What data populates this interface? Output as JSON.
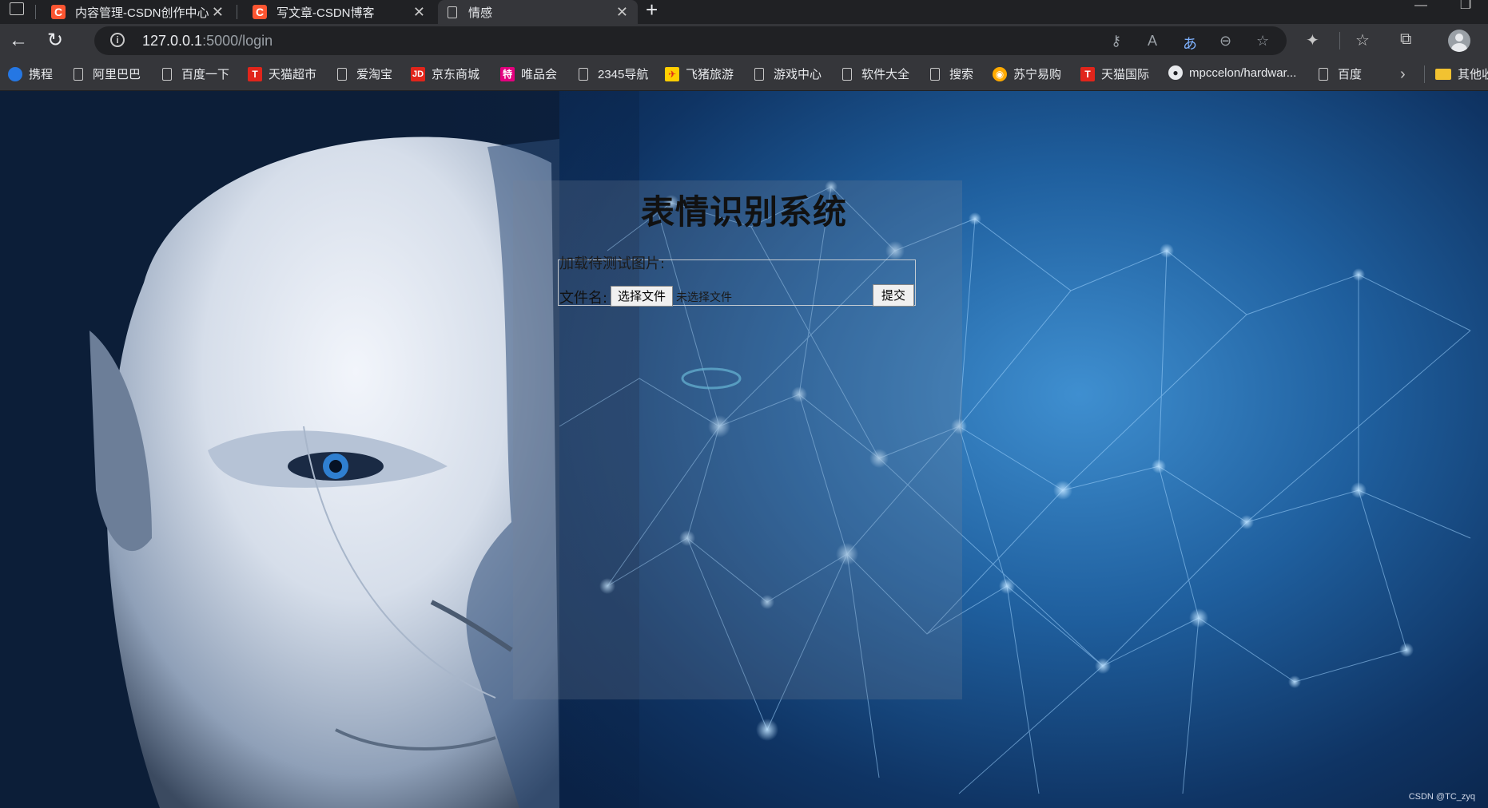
{
  "browser": {
    "tabs": [
      {
        "title": "内容管理-CSDN创作中心",
        "icon": "csdn-icon"
      },
      {
        "title": "写文章-CSDN博客",
        "icon": "csdn-icon"
      },
      {
        "title": "情感",
        "icon": "page-icon",
        "active": true
      }
    ],
    "new_tab_symbol": "+",
    "address": {
      "host": "127.0.0.1",
      "rest": ":5000/login"
    },
    "bookmarks": [
      {
        "label": "携程",
        "icon": "ctrip-icon"
      },
      {
        "label": "阿里巴巴",
        "icon": "page-icon"
      },
      {
        "label": "百度一下",
        "icon": "page-icon"
      },
      {
        "label": "天猫超市",
        "icon": "tmall-icon"
      },
      {
        "label": "爱淘宝",
        "icon": "page-icon"
      },
      {
        "label": "京东商城",
        "icon": "jd-icon"
      },
      {
        "label": "唯品会",
        "icon": "vip-icon"
      },
      {
        "label": "2345导航",
        "icon": "page-icon"
      },
      {
        "label": "飞猪旅游",
        "icon": "fliggy-icon"
      },
      {
        "label": "游戏中心",
        "icon": "page-icon"
      },
      {
        "label": "软件大全",
        "icon": "page-icon"
      },
      {
        "label": "搜索",
        "icon": "page-icon"
      },
      {
        "label": "苏宁易购",
        "icon": "suning-icon"
      },
      {
        "label": "天猫国际",
        "icon": "tmall-icon"
      },
      {
        "label": "mpccelon/hardwar...",
        "icon": "github-icon"
      },
      {
        "label": "百度",
        "icon": "page-icon"
      },
      {
        "label": "其他收",
        "icon": "folder-icon"
      }
    ],
    "icon_glyphs": {
      "tmall": "T",
      "jd": "JD",
      "vip": "特",
      "gh": "●"
    }
  },
  "page": {
    "title": "表情识别系统",
    "load_label": "加载待测试图片:",
    "filename_label": "文件名:",
    "choose_button": "选择文件",
    "no_file_text": "未选择文件",
    "submit_button": "提交",
    "watermark": "CSDN @TC_zyq"
  },
  "colors": {
    "csdn": "#fc5531",
    "chrome_dark": "#202124",
    "chrome_toolbar": "#35363a"
  }
}
